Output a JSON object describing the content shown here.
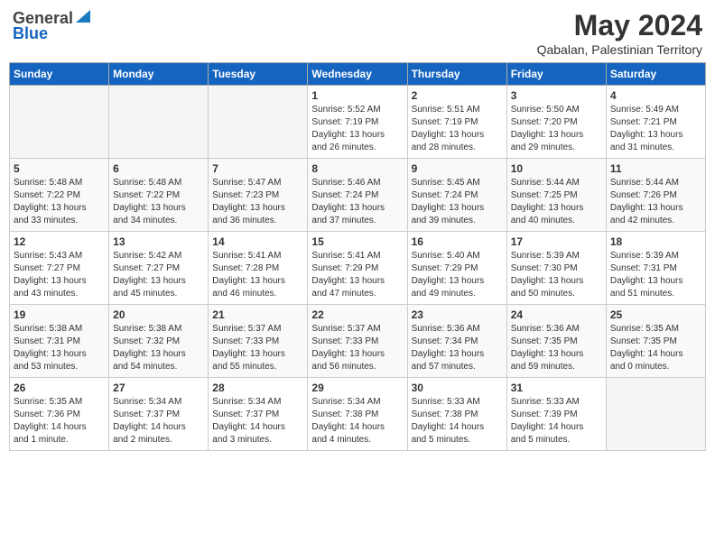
{
  "logo": {
    "line1": "General",
    "line2": "Blue"
  },
  "title": "May 2024",
  "location": "Qabalan, Palestinian Territory",
  "days_of_week": [
    "Sunday",
    "Monday",
    "Tuesday",
    "Wednesday",
    "Thursday",
    "Friday",
    "Saturday"
  ],
  "weeks": [
    [
      {
        "num": "",
        "info": ""
      },
      {
        "num": "",
        "info": ""
      },
      {
        "num": "",
        "info": ""
      },
      {
        "num": "1",
        "info": "Sunrise: 5:52 AM\nSunset: 7:19 PM\nDaylight: 13 hours\nand 26 minutes."
      },
      {
        "num": "2",
        "info": "Sunrise: 5:51 AM\nSunset: 7:19 PM\nDaylight: 13 hours\nand 28 minutes."
      },
      {
        "num": "3",
        "info": "Sunrise: 5:50 AM\nSunset: 7:20 PM\nDaylight: 13 hours\nand 29 minutes."
      },
      {
        "num": "4",
        "info": "Sunrise: 5:49 AM\nSunset: 7:21 PM\nDaylight: 13 hours\nand 31 minutes."
      }
    ],
    [
      {
        "num": "5",
        "info": "Sunrise: 5:48 AM\nSunset: 7:22 PM\nDaylight: 13 hours\nand 33 minutes."
      },
      {
        "num": "6",
        "info": "Sunrise: 5:48 AM\nSunset: 7:22 PM\nDaylight: 13 hours\nand 34 minutes."
      },
      {
        "num": "7",
        "info": "Sunrise: 5:47 AM\nSunset: 7:23 PM\nDaylight: 13 hours\nand 36 minutes."
      },
      {
        "num": "8",
        "info": "Sunrise: 5:46 AM\nSunset: 7:24 PM\nDaylight: 13 hours\nand 37 minutes."
      },
      {
        "num": "9",
        "info": "Sunrise: 5:45 AM\nSunset: 7:24 PM\nDaylight: 13 hours\nand 39 minutes."
      },
      {
        "num": "10",
        "info": "Sunrise: 5:44 AM\nSunset: 7:25 PM\nDaylight: 13 hours\nand 40 minutes."
      },
      {
        "num": "11",
        "info": "Sunrise: 5:44 AM\nSunset: 7:26 PM\nDaylight: 13 hours\nand 42 minutes."
      }
    ],
    [
      {
        "num": "12",
        "info": "Sunrise: 5:43 AM\nSunset: 7:27 PM\nDaylight: 13 hours\nand 43 minutes."
      },
      {
        "num": "13",
        "info": "Sunrise: 5:42 AM\nSunset: 7:27 PM\nDaylight: 13 hours\nand 45 minutes."
      },
      {
        "num": "14",
        "info": "Sunrise: 5:41 AM\nSunset: 7:28 PM\nDaylight: 13 hours\nand 46 minutes."
      },
      {
        "num": "15",
        "info": "Sunrise: 5:41 AM\nSunset: 7:29 PM\nDaylight: 13 hours\nand 47 minutes."
      },
      {
        "num": "16",
        "info": "Sunrise: 5:40 AM\nSunset: 7:29 PM\nDaylight: 13 hours\nand 49 minutes."
      },
      {
        "num": "17",
        "info": "Sunrise: 5:39 AM\nSunset: 7:30 PM\nDaylight: 13 hours\nand 50 minutes."
      },
      {
        "num": "18",
        "info": "Sunrise: 5:39 AM\nSunset: 7:31 PM\nDaylight: 13 hours\nand 51 minutes."
      }
    ],
    [
      {
        "num": "19",
        "info": "Sunrise: 5:38 AM\nSunset: 7:31 PM\nDaylight: 13 hours\nand 53 minutes."
      },
      {
        "num": "20",
        "info": "Sunrise: 5:38 AM\nSunset: 7:32 PM\nDaylight: 13 hours\nand 54 minutes."
      },
      {
        "num": "21",
        "info": "Sunrise: 5:37 AM\nSunset: 7:33 PM\nDaylight: 13 hours\nand 55 minutes."
      },
      {
        "num": "22",
        "info": "Sunrise: 5:37 AM\nSunset: 7:33 PM\nDaylight: 13 hours\nand 56 minutes."
      },
      {
        "num": "23",
        "info": "Sunrise: 5:36 AM\nSunset: 7:34 PM\nDaylight: 13 hours\nand 57 minutes."
      },
      {
        "num": "24",
        "info": "Sunrise: 5:36 AM\nSunset: 7:35 PM\nDaylight: 13 hours\nand 59 minutes."
      },
      {
        "num": "25",
        "info": "Sunrise: 5:35 AM\nSunset: 7:35 PM\nDaylight: 14 hours\nand 0 minutes."
      }
    ],
    [
      {
        "num": "26",
        "info": "Sunrise: 5:35 AM\nSunset: 7:36 PM\nDaylight: 14 hours\nand 1 minute."
      },
      {
        "num": "27",
        "info": "Sunrise: 5:34 AM\nSunset: 7:37 PM\nDaylight: 14 hours\nand 2 minutes."
      },
      {
        "num": "28",
        "info": "Sunrise: 5:34 AM\nSunset: 7:37 PM\nDaylight: 14 hours\nand 3 minutes."
      },
      {
        "num": "29",
        "info": "Sunrise: 5:34 AM\nSunset: 7:38 PM\nDaylight: 14 hours\nand 4 minutes."
      },
      {
        "num": "30",
        "info": "Sunrise: 5:33 AM\nSunset: 7:38 PM\nDaylight: 14 hours\nand 5 minutes."
      },
      {
        "num": "31",
        "info": "Sunrise: 5:33 AM\nSunset: 7:39 PM\nDaylight: 14 hours\nand 5 minutes."
      },
      {
        "num": "",
        "info": ""
      }
    ]
  ]
}
